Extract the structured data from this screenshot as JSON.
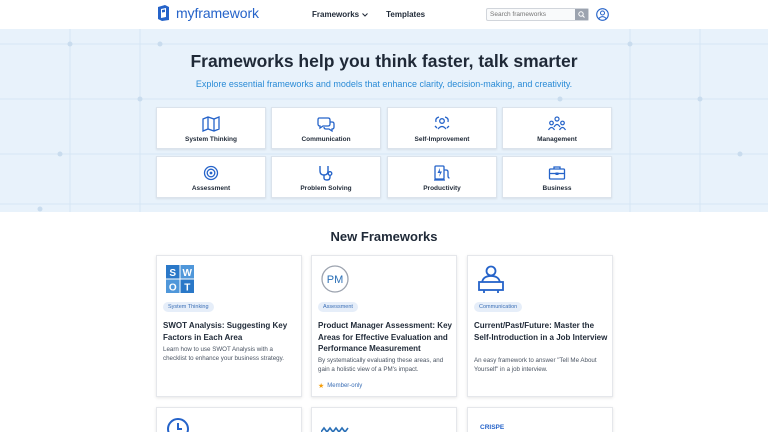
{
  "header": {
    "logo_text": "myframework",
    "nav": [
      {
        "label": "Frameworks",
        "has_dropdown": true
      },
      {
        "label": "Templates",
        "has_dropdown": false
      }
    ],
    "search_placeholder": "Search frameworks",
    "icons": {
      "search": "search-icon",
      "account": "user-circle-icon",
      "logo": "book-logo-icon"
    }
  },
  "hero": {
    "title": "Frameworks help you think faster, talk smarter",
    "subtitle": "Explore essential frameworks and models that enhance clarity, decision-making, and creativity.",
    "categories": [
      {
        "label": "System Thinking",
        "icon": "map-icon"
      },
      {
        "label": "Communication",
        "icon": "chat-bubbles-icon"
      },
      {
        "label": "Self-Improvement",
        "icon": "person-growth-icon"
      },
      {
        "label": "Management",
        "icon": "team-icon"
      },
      {
        "label": "Assessment",
        "icon": "target-icon"
      },
      {
        "label": "Problem Solving",
        "icon": "stethoscope-icon"
      },
      {
        "label": "Productivity",
        "icon": "charging-icon"
      },
      {
        "label": "Business",
        "icon": "briefcase-icon"
      }
    ]
  },
  "new_frameworks": {
    "title": "New Frameworks",
    "cards": [
      {
        "tag": "System Thinking",
        "title": "SWOT Analysis: Suggesting Key Factors in Each Area",
        "description": "Learn how to use SWOT Analysis with a checklist to enhance your business strategy.",
        "thumb": "swot-icon",
        "thumb_text": [
          "S",
          "W",
          "O",
          "T"
        ],
        "member_only": ""
      },
      {
        "tag": "Assessment",
        "title": "Product Manager Assessment: Key Areas for Effective Evaluation and Performance Measurement",
        "description": "By systematically evaluating these areas, and gain a holistic view of a PM's impact.",
        "thumb": "pm-icon",
        "thumb_text": "PM",
        "member_only": "Member-only"
      },
      {
        "tag": "Communication",
        "title": "Current/Past/Future: Master the Self-Introduction in a Job Interview",
        "description": "An easy framework to answer \"Tell Me About Yourself\" in a job interview.",
        "thumb": "presenter-icon",
        "member_only": ""
      }
    ],
    "next_row_partial": [
      {
        "thumb": "clock-icon"
      },
      {
        "thumb": "wave-icon"
      },
      {
        "thumb_text": "CRISPE"
      }
    ]
  },
  "colors": {
    "brand": "#2563c9",
    "hero_bg": "#e8f2fb",
    "subtitle": "#2a8bd6",
    "tag_bg": "#e6eef9",
    "star": "#f59e0b"
  }
}
